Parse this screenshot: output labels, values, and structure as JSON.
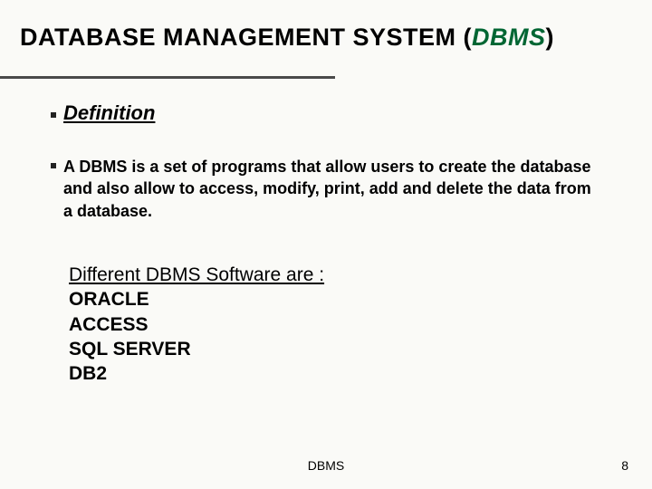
{
  "title": {
    "prefix": "DATABASE MANAGEMENT SYSTEM (",
    "emph": "DBMS",
    "suffix": ")"
  },
  "section_heading": "Definition",
  "definition_body": "A DBMS is a set of programs that allow users to create the database and also allow to access, modify, print, add and delete the data from a database.",
  "software": {
    "heading": "Different DBMS Software are :",
    "items": [
      "ORACLE",
      "ACCESS",
      "SQL SERVER",
      "DB2"
    ]
  },
  "footer": {
    "center": "DBMS",
    "page": "8"
  }
}
